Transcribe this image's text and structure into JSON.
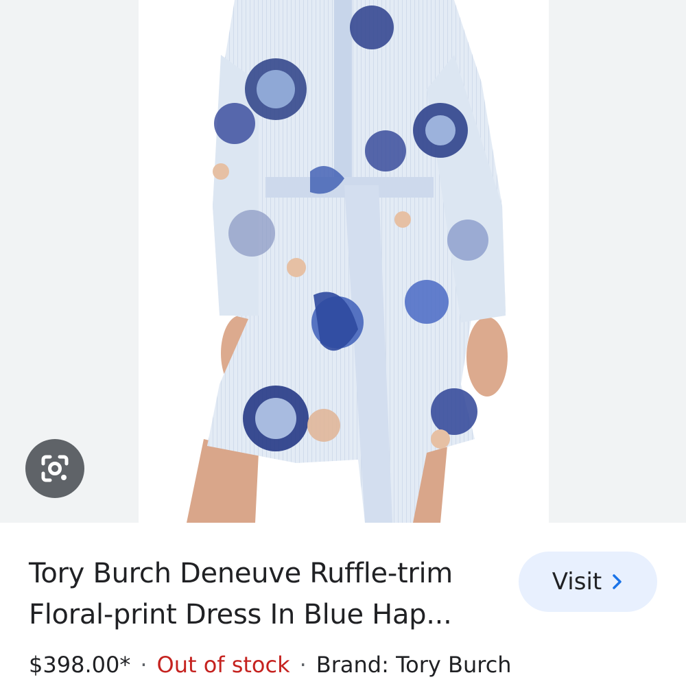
{
  "product": {
    "title_line1": "Tory Burch Deneuve Ruffle-trim",
    "title_line2": "Floral-print Dress In Blue Hap...",
    "price": "$398.00*",
    "stock_status": "Out of stock",
    "brand": "Brand: Tory Burch",
    "separator": "·"
  },
  "actions": {
    "visit_label": "Visit",
    "visit_icon": "chevron-right-icon",
    "lens_icon": "google-lens-icon"
  },
  "colors": {
    "stock_out": "#c5221f",
    "visit_bg": "#e8f0fe",
    "visit_chevron": "#1a73e8",
    "lens_bg": "#5f6368",
    "viewer_bg": "#f1f3f4"
  }
}
